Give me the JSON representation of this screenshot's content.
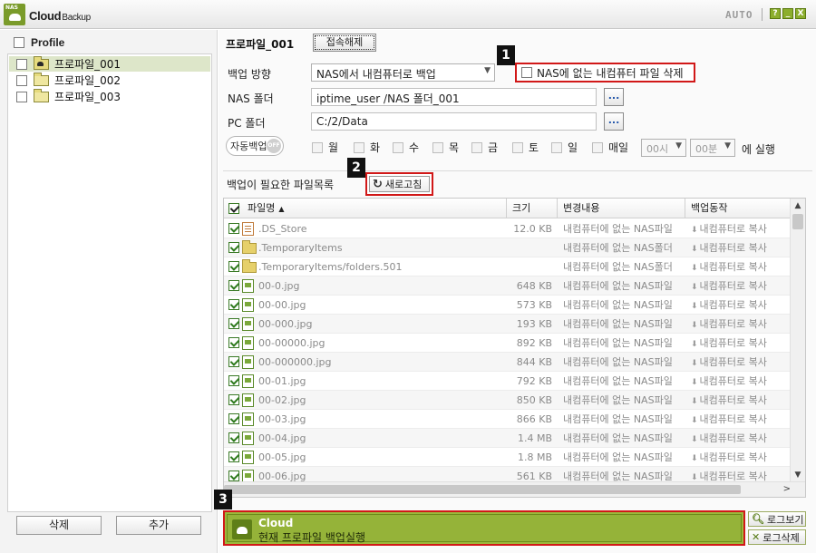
{
  "titlebar": {
    "app_name": "Cloud",
    "app_sub": "Backup",
    "logo_text": "NAS",
    "auto_label": "AUTO",
    "help_icon": "?",
    "minimize_icon": "_",
    "close_icon": "X"
  },
  "sidebar": {
    "header_label": "Profile",
    "items": [
      {
        "label": "프로파일_001",
        "selected": true
      },
      {
        "label": "프로파일_002",
        "selected": false
      },
      {
        "label": "프로파일_003",
        "selected": false
      }
    ],
    "delete_button": "삭제",
    "add_button": "추가"
  },
  "profile": {
    "name": "프로파일_001",
    "disconnect_button": "접속해제",
    "direction_label": "백업 방향",
    "direction_value": "NAS에서 내컴퓨터로 백업",
    "delete_option_label": "NAS에 없는 내컴퓨터 파일 삭제",
    "nas_folder_label": "NAS 폴더",
    "nas_folder_value": "iptime_user /NAS 폴더_001",
    "pc_folder_label": "PC 폴더",
    "pc_folder_value": "C:/2/Data",
    "browse_label": "...",
    "auto_backup_label": "자동백업",
    "auto_backup_state": "OFF",
    "days": [
      "월",
      "화",
      "수",
      "목",
      "금",
      "토",
      "일",
      "매일"
    ],
    "hour_value": "00시",
    "minute_value": "00분",
    "run_suffix": "에 실행"
  },
  "file_list": {
    "title": "백업이 필요한 파일목록",
    "refresh_button": "새로고침",
    "columns": [
      "파일명",
      "크기",
      "변경내용",
      "백업동작"
    ],
    "rows": [
      {
        "icon": "doc",
        "name": ".DS_Store",
        "size": "12.0 KB",
        "change": "내컴퓨터에 없는 NAS파일",
        "action": "내컴퓨터로 복사"
      },
      {
        "icon": "folder",
        "name": ".TemporaryItems",
        "size": "",
        "change": "내컴퓨터에 없는 NAS폴더",
        "action": "내컴퓨터로 복사"
      },
      {
        "icon": "folder",
        "name": ".TemporaryItems/folders.501",
        "size": "",
        "change": "내컴퓨터에 없는 NAS폴더",
        "action": "내컴퓨터로 복사"
      },
      {
        "icon": "image",
        "name": "00-0.jpg",
        "size": "648 KB",
        "change": "내컴퓨터에 없는 NAS파일",
        "action": "내컴퓨터로 복사"
      },
      {
        "icon": "image",
        "name": "00-00.jpg",
        "size": "573 KB",
        "change": "내컴퓨터에 없는 NAS파일",
        "action": "내컴퓨터로 복사"
      },
      {
        "icon": "image",
        "name": "00-000.jpg",
        "size": "193 KB",
        "change": "내컴퓨터에 없는 NAS파일",
        "action": "내컴퓨터로 복사"
      },
      {
        "icon": "image",
        "name": "00-00000.jpg",
        "size": "892 KB",
        "change": "내컴퓨터에 없는 NAS파일",
        "action": "내컴퓨터로 복사"
      },
      {
        "icon": "image",
        "name": "00-000000.jpg",
        "size": "844 KB",
        "change": "내컴퓨터에 없는 NAS파일",
        "action": "내컴퓨터로 복사"
      },
      {
        "icon": "image",
        "name": "00-01.jpg",
        "size": "792 KB",
        "change": "내컴퓨터에 없는 NAS파일",
        "action": "내컴퓨터로 복사"
      },
      {
        "icon": "image",
        "name": "00-02.jpg",
        "size": "850 KB",
        "change": "내컴퓨터에 없는 NAS파일",
        "action": "내컴퓨터로 복사"
      },
      {
        "icon": "image",
        "name": "00-03.jpg",
        "size": "866 KB",
        "change": "내컴퓨터에 없는 NAS파일",
        "action": "내컴퓨터로 복사"
      },
      {
        "icon": "image",
        "name": "00-04.jpg",
        "size": "1.4 MB",
        "change": "내컴퓨터에 없는 NAS파일",
        "action": "내컴퓨터로 복사"
      },
      {
        "icon": "image",
        "name": "00-05.jpg",
        "size": "1.8 MB",
        "change": "내컴퓨터에 없는 NAS파일",
        "action": "내컴퓨터로 복사"
      },
      {
        "icon": "image",
        "name": "00-06.jpg",
        "size": "561 KB",
        "change": "내컴퓨터에 없는 NAS파일",
        "action": "내컴퓨터로 복사"
      }
    ]
  },
  "run": {
    "title": "Cloud",
    "subtitle": "현재 프로파일 백업실행"
  },
  "logs": {
    "view_button": "로그보기",
    "delete_button": "로그삭제"
  },
  "callouts": [
    "1",
    "2",
    "3"
  ],
  "colors": {
    "accent_green": "#95b339",
    "highlight_red": "#d11818",
    "selected_row": "#dde6c9"
  }
}
